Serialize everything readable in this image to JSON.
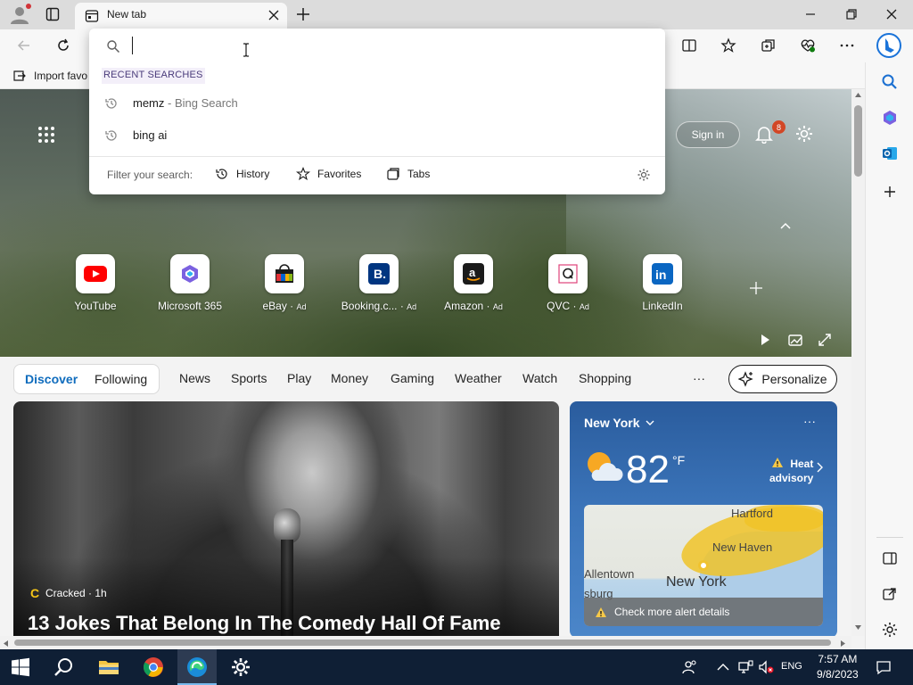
{
  "tab": {
    "title": "New tab"
  },
  "favorites_bar": {
    "import_label": "Import favo"
  },
  "omnibox": {
    "placeholder": "",
    "section_title": "RECENT SEARCHES",
    "recent": [
      {
        "query": "memz",
        "suffix": " - Bing Search"
      },
      {
        "query": "bing ai",
        "suffix": ""
      }
    ],
    "filter_label": "Filter your search:",
    "filters": [
      "History",
      "Favorites",
      "Tabs"
    ]
  },
  "hero": {
    "sign_in": "Sign in",
    "notification_count": "8"
  },
  "quick_links": [
    {
      "label": "YouTube",
      "ad": ""
    },
    {
      "label": "Microsoft 365",
      "ad": ""
    },
    {
      "label": "eBay",
      "ad": "Ad"
    },
    {
      "label": "Booking.c...",
      "ad": "Ad"
    },
    {
      "label": "Amazon",
      "ad": "Ad"
    },
    {
      "label": "QVC",
      "ad": "Ad"
    },
    {
      "label": "LinkedIn",
      "ad": ""
    }
  ],
  "feed_nav": {
    "primary": [
      "Discover",
      "Following"
    ],
    "items": [
      "News",
      "Sports",
      "Play",
      "Money",
      "Gaming",
      "Weather",
      "Watch",
      "Shopping"
    ],
    "more": "···",
    "personalize": "Personalize"
  },
  "article": {
    "source": "Cracked · 1h",
    "source_logo": "C",
    "headline": "13 Jokes That Belong In The Comedy Hall Of Fame"
  },
  "weather": {
    "city": "New York",
    "more": "···",
    "temp": "82",
    "unit": "°F",
    "alert_line1": "Heat",
    "alert_line2": "advisory",
    "map_labels": {
      "hartford": "Hartford",
      "new_haven": "New Haven",
      "allentown": "Allentown",
      "sburg": "sburg",
      "new_york": "New York"
    },
    "alert_banner": "Check more alert details"
  },
  "taskbar": {
    "language": "ENG",
    "time": "7:57 AM",
    "date": "9/8/2023"
  },
  "colors": {
    "accent": "#0f6cbd",
    "discover": "#0f6cbd",
    "taskbar": "#0f1f35",
    "badge": "#d24726"
  }
}
